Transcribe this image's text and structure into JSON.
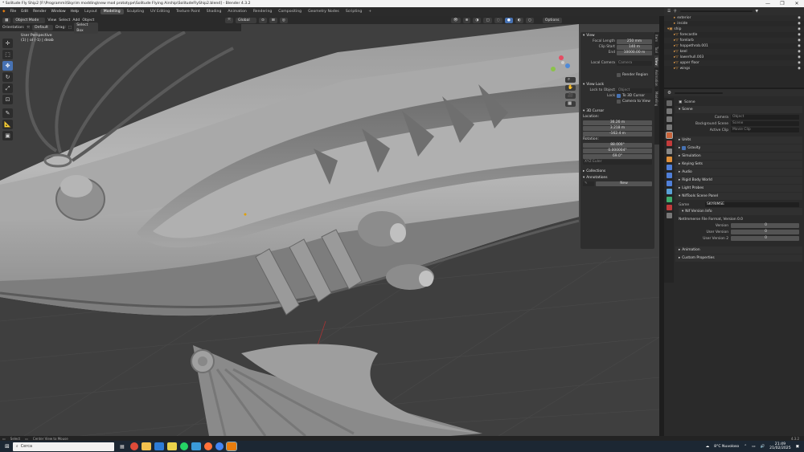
{
  "window": {
    "title": "* Solitude Fly Ship2 [F:\\Programmi\\Skyrim modding\\new mod prototype\\Solitude Flying Airship\\SolitudeFlyShip2.blend] - Blender 4.3.2",
    "controls": [
      "—",
      "❐",
      "✕"
    ]
  },
  "menu": {
    "items": [
      "File",
      "Edit",
      "Render",
      "Window",
      "Help"
    ],
    "workspaces": [
      "Layout",
      "Modeling",
      "Sculpting",
      "UV Editing",
      "Texture Paint",
      "Shading",
      "Animation",
      "Rendering",
      "Compositing",
      "Geometry Nodes",
      "Scripting"
    ],
    "active_workspace": "Modeling",
    "scene": "Scene",
    "view_layer": "ViewLayer"
  },
  "viewport_header": {
    "mode": "Object Mode",
    "menus": [
      "View",
      "Select",
      "Add",
      "Object"
    ],
    "transform": "Global",
    "options": "Options"
  },
  "viewport_header2": {
    "orientation_label": "Orientation:",
    "orientation": "Default",
    "drag_label": "Drag:",
    "drag": "Select Box"
  },
  "viewport_info": {
    "line1": "User Perspective",
    "line2": "(1) | ol (-1) | deab"
  },
  "toolbar_tools": [
    "cursor-icon",
    "select-box-icon",
    "move-icon",
    "rotate-icon",
    "scale-icon",
    "transform-icon",
    "annotate-icon",
    "measure-icon",
    "add-cube-icon"
  ],
  "n_panel": {
    "view_section": "View",
    "focal_length_label": "Focal Length",
    "focal_length": "250 mm",
    "clip_start_label": "Clip Start",
    "clip_start": "140 m",
    "clip_end_label": "End",
    "clip_end": "10000.00 m",
    "local_camera_label": "Local Camera",
    "local_camera": "Camera",
    "render_region": "Render Region",
    "view_lock_section": "View Lock",
    "lock_to_object_label": "Lock to Object",
    "lock_object": "Object",
    "lock_label": "Lock",
    "to_3d_cursor": "To 3D Cursor",
    "camera_to_view": "Camera to View",
    "cursor_section": "3D Cursor",
    "location_label": "Location:",
    "loc_x": "36.26 m",
    "loc_y": "3.218 m",
    "loc_z": "-162.4 m",
    "rotation_label": "Rotation:",
    "rot_x": "88.000°",
    "rot_y": "0.000004°",
    "rot_z": "69.0°",
    "rotation_mode": "XYZ Euler",
    "collections_section": "Collections",
    "annotations_section": "Annotations",
    "new_button": "New",
    "tabs": [
      "Item",
      "Tool",
      "View",
      "Animation",
      "Modeling"
    ]
  },
  "outliner": {
    "search": "",
    "rows": [
      {
        "name": "exterior",
        "indent": 1
      },
      {
        "name": "inside",
        "indent": 1
      },
      {
        "name": "ship",
        "indent": 0
      },
      {
        "name": "forecastle",
        "indent": 1
      },
      {
        "name": "forelarb",
        "indent": 1
      },
      {
        "name": "hoppethrob.001",
        "indent": 1
      },
      {
        "name": "keel",
        "indent": 1
      },
      {
        "name": "lowerhull.003",
        "indent": 1
      },
      {
        "name": "upper floor",
        "indent": 1
      },
      {
        "name": "wings",
        "indent": 1
      }
    ]
  },
  "properties": {
    "scene_name": "Scene",
    "scene_section": "Scene",
    "camera_label": "Camera",
    "camera_value": "Object",
    "background_scene_label": "Background Scene",
    "background_scene_value": "Scene",
    "active_clip_label": "Active Clip",
    "active_clip_value": "Movie Clip",
    "sections": [
      "Units",
      "Gravity",
      "Simulation",
      "Keying Sets",
      "Audio",
      "Rigid Body World",
      "Light Probes",
      "NifTools Scene Panel"
    ],
    "game_label": "Game",
    "game_value": "SKYRIMSE",
    "nif_version_section": "Nif Version Info",
    "nif_format": "NetImmerse File Format, Version 0.0",
    "version_label": "Version",
    "version_value": "0",
    "user_version_label": "User Version",
    "user_version_value": "0",
    "user_version2_label": "User Version 2",
    "user_version2_value": "0",
    "tail_sections": [
      "Animation",
      "Custom Properties"
    ]
  },
  "statusbar": {
    "left1": "Select",
    "left2": "Center View to Mouse",
    "version": "4.3.2"
  },
  "taskbar": {
    "search_placeholder": "Cerca",
    "weather": "8°C Nuvoloso",
    "time": "21:49",
    "date": "21/02/2025"
  }
}
